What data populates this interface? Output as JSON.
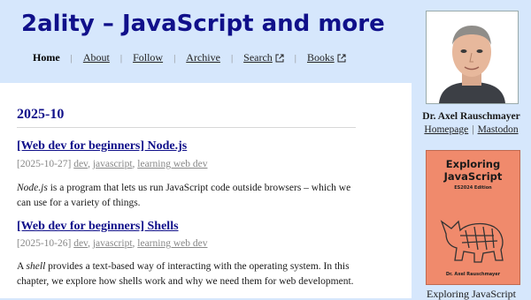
{
  "site": {
    "title": "2ality – JavaScript and more"
  },
  "nav": {
    "home": "Home",
    "about": "About",
    "follow": "Follow",
    "archive": "Archive",
    "search": "Search",
    "books": "Books",
    "separator": "|"
  },
  "main": {
    "month": "2025-10",
    "posts": [
      {
        "title": "[Web dev for beginners] Node.js",
        "date": "[2025-10-27]",
        "tags": [
          "dev",
          "javascript",
          "learning web dev"
        ],
        "excerpt_term": "Node.js",
        "excerpt_rest": " is a program that lets us run JavaScript code outside browsers – which we can use for a variety of things."
      },
      {
        "title": "[Web dev for beginners] Shells",
        "date": "[2025-10-26]",
        "tags": [
          "dev",
          "javascript",
          "learning web dev"
        ],
        "excerpt_lead": "A ",
        "excerpt_term": "shell",
        "excerpt_rest": " provides a text-based way of interacting with the operating system. In this chapter, we explore how shells work and why we need them for web development."
      }
    ]
  },
  "sidebar": {
    "author_name": "Dr. Axel Rauschmayer",
    "homepage_label": "Homepage",
    "mastodon_label": "Mastodon",
    "separator": "|",
    "book": {
      "cover_title_line1": "Exploring",
      "cover_title_line2": "JavaScript",
      "cover_edition": "ES2024 Edition",
      "cover_author": "Dr. Axel Rauschmayer",
      "caption": "Exploring JavaScript"
    }
  },
  "icons": {
    "external_link": "external-link-icon"
  },
  "colors": {
    "background": "#d6e7fc",
    "title": "#10108a",
    "book_cover": "#f08a6c"
  }
}
